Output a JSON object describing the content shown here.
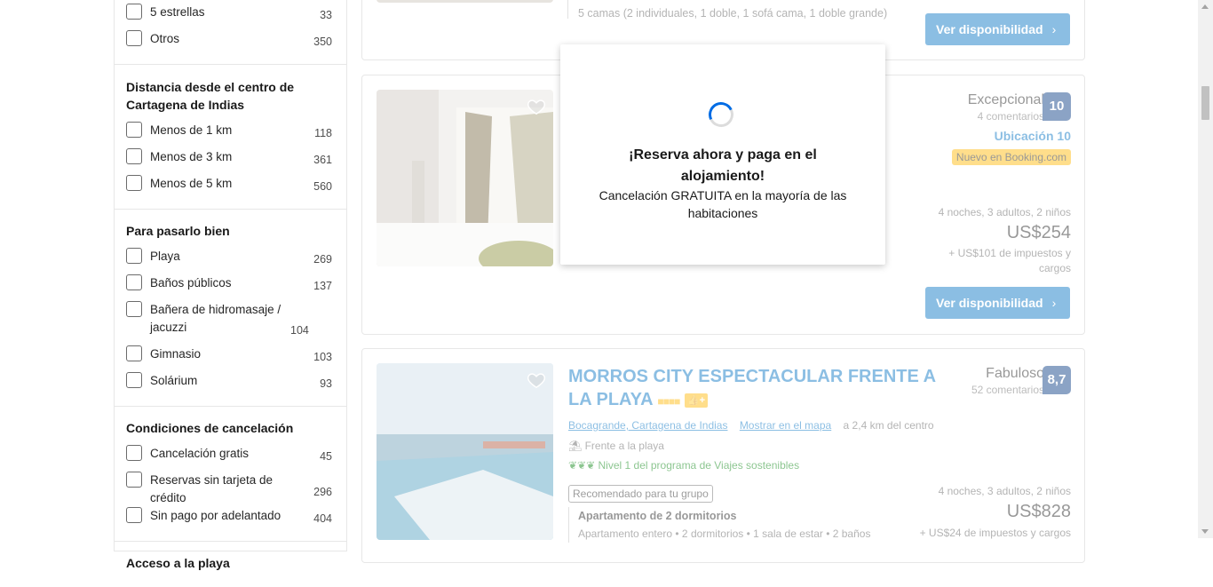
{
  "sidebar": {
    "stars": {
      "items": [
        {
          "label": "5 estrellas",
          "count": "33"
        },
        {
          "label": "Otros",
          "count": "350"
        }
      ]
    },
    "distance": {
      "title": "Distancia desde el centro de Cartagena de Indias",
      "items": [
        {
          "label": "Menos de 1 km",
          "count": "118"
        },
        {
          "label": "Menos de 3 km",
          "count": "361"
        },
        {
          "label": "Menos de 5 km",
          "count": "560"
        }
      ]
    },
    "fun": {
      "title": "Para pasarlo bien",
      "items": [
        {
          "label": "Playa",
          "count": "269"
        },
        {
          "label": "Baños públicos",
          "count": "137"
        },
        {
          "label": "Bañera de hidromasaje / jacuzzi",
          "count": "104"
        },
        {
          "label": "Gimnasio",
          "count": "103"
        },
        {
          "label": "Solárium",
          "count": "93"
        }
      ]
    },
    "cancel": {
      "title": "Condiciones de cancelación",
      "items": [
        {
          "label": "Cancelación gratis",
          "count": "45"
        },
        {
          "label": "Reservas sin tarjeta de crédito",
          "count": "296"
        },
        {
          "label": "Sin pago por adelantado",
          "count": "404"
        }
      ]
    },
    "beach": {
      "title": "Acceso a la playa"
    }
  },
  "card_top": {
    "beds": "5 camas (2 individuales, 1 doble, 1 sofá cama, 1 doble grande)",
    "button": "Ver disponibilidad"
  },
  "card_middle": {
    "rating_word": "Excepcional",
    "reviews": "4 comentarios",
    "score": "10",
    "location_score": "Ubicación 10",
    "badge": "Nuevo en Booking.com",
    "stay": "4 noches, 3 adultos, 2 niños",
    "price": "US$254",
    "taxes": "+ US$101 de impuestos y cargos",
    "button": "Ver disponibilidad"
  },
  "card_bottom": {
    "title": "MORROS CITY ESPECTACULAR FRENTE A LA PLAYA",
    "rating_word": "Fabuloso",
    "reviews": "52 comentarios",
    "score": "8,7",
    "area": "Bocagrande, Cartagena de Indias",
    "map_link": "Mostrar en el mapa",
    "distance": "a 2,4 km del centro",
    "beachfront": "Frente a la playa",
    "sustainable": "Nivel 1 del programa de Viajes sostenibles",
    "recommended": "Recomendado para tu grupo",
    "unit": "Apartamento de 2 dormitorios",
    "unit_detail": "Apartamento entero • 2 dormitorios • 1 sala de estar • 2 baños",
    "stay": "4 noches, 3 adultos, 2 niños",
    "price": "US$828",
    "taxes": "+ US$24 de impuestos y cargos"
  },
  "modal": {
    "title": "¡Reserva ahora y paga en el alojamiento!",
    "subtitle": "Cancelación GRATUITA en la mayoría de las habitaciones"
  },
  "colors": {
    "primary": "#0071c2",
    "score_bg": "#003580",
    "badge_bg": "#ffb700",
    "sustainable": "#008009"
  }
}
